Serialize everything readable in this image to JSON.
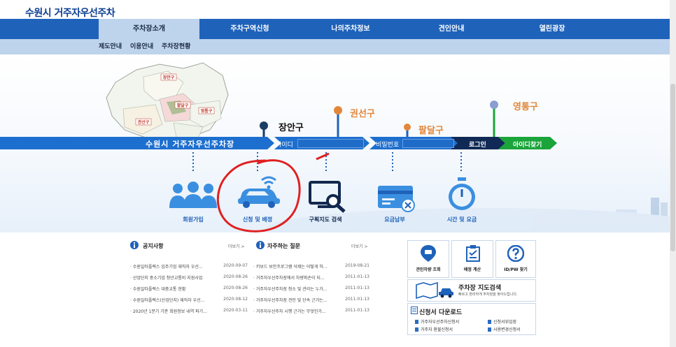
{
  "header": {
    "site_title": "수원시 거주자우선주차"
  },
  "gnb": {
    "items": [
      {
        "label": "주차장소개"
      },
      {
        "label": "주차구역신청"
      },
      {
        "label": "나의주차정보"
      },
      {
        "label": "견인안내"
      },
      {
        "label": "열린광장"
      }
    ]
  },
  "subnav": {
    "items": [
      {
        "label": "제도안내"
      },
      {
        "label": "이용안내"
      },
      {
        "label": "주차장현황"
      }
    ]
  },
  "hero": {
    "map_districts": [
      "장안구",
      "권선구",
      "팔달구",
      "영통구"
    ],
    "pins": [
      {
        "label": "장안구",
        "color": "#1a3d66"
      },
      {
        "label": "권선구",
        "color": "#e2873a"
      },
      {
        "label": "팔달구",
        "color": "#e2873a"
      },
      {
        "label": "영통구",
        "color": "#8a9ed1"
      }
    ],
    "banner_title": "수원시 거주자우선주차장",
    "id_label": "아이디",
    "pw_label": "비밀번호",
    "login_label": "로그인",
    "find_id_label": "아이디찾기",
    "colors": {
      "banner": "#1d6fcf",
      "login": "#102a55",
      "find": "#1aa43a",
      "annotation": "#e02020"
    }
  },
  "quick_icons": [
    {
      "label": "회원가입",
      "icon": "people-icon"
    },
    {
      "label": "신청 및 배정",
      "icon": "car-wifi-icon"
    },
    {
      "label": "구획지도 검색",
      "icon": "monitor-search-icon"
    },
    {
      "label": "요금납부",
      "icon": "card-icon"
    },
    {
      "label": "시간 및 요금",
      "icon": "stopwatch-icon"
    }
  ],
  "notice": {
    "title": "공지사항",
    "more": "더보기 >",
    "rows": [
      {
        "title": "· 수원일타플렉스 입주기업 재직자 우선...",
        "date": "2020-09-07"
      },
      {
        "title": "· 산업단지 중소기업 청년교통비 지원사업",
        "date": "2020-08-26"
      },
      {
        "title": "· 수원일타플렉스 대중교통 현황",
        "date": "2020-08-26"
      },
      {
        "title": "· 수원일타플렉스(산업단지) 재직자 우선...",
        "date": "2020-08-12"
      },
      {
        "title": "· 2020년 1분기 기준 회원정보 내역 파기...",
        "date": "2020-03-11"
      }
    ]
  },
  "faq": {
    "title": "자주하는 질문",
    "more": "더보기 >",
    "rows": [
      {
        "title": "· 키보드 보안프로그램 삭제는 어떻게 하...",
        "date": "2019-08-21"
      },
      {
        "title": "· 거주자우선주차장에서 차량파손이 되...",
        "date": "2011-01-13"
      },
      {
        "title": "· 거주자우선주차장 청소 및 관리는 누가...",
        "date": "2011-01-13"
      },
      {
        "title": "· 거주자우선주차장 견인 및 단속 근거는...",
        "date": "2011-01-13"
      },
      {
        "title": "· 거주자우선주차 시행 근거는 무엇인가...",
        "date": "2011-01-13"
      }
    ]
  },
  "quick_boxes": [
    {
      "label": "견인차량 조회",
      "icon": "tow-pin-icon"
    },
    {
      "label": "배정 계산",
      "icon": "clipboard-icon"
    },
    {
      "label": "ID/PW 찾기",
      "icon": "question-icon"
    }
  ],
  "map_search": {
    "title": "주차장 지도검색",
    "desc": "빠르고 편리하게 주차장을 찾아드립니다."
  },
  "downloads": {
    "title": "신청서 다운로드",
    "items": [
      {
        "label": "거주자우선주차신청서"
      },
      {
        "label": "신청서위임장"
      },
      {
        "label": "거주자 환불신청서"
      },
      {
        "label": "사용변경신청서"
      }
    ]
  }
}
